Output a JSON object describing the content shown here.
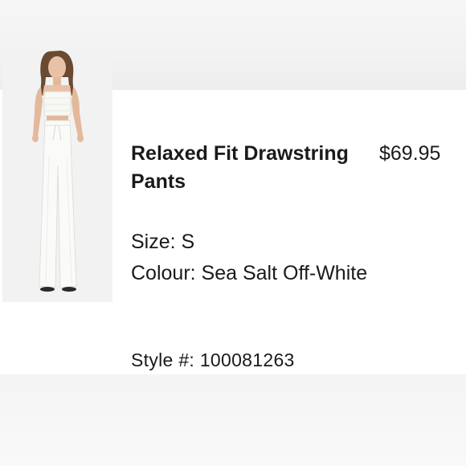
{
  "product": {
    "image_alt": "model-wearing-white-drawstring-pants",
    "title": "Relaxed Fit Drawstring Pants",
    "price": "$69.95",
    "size_label": "Size:",
    "size_value": "S",
    "colour_label": "Colour:",
    "colour_value": "Sea Salt Off-White",
    "style_label": "Style #:",
    "style_value": "100081263"
  },
  "colors": {
    "text": "#1a1a1a",
    "background": "#ffffff",
    "band": "#f3f3f3"
  }
}
